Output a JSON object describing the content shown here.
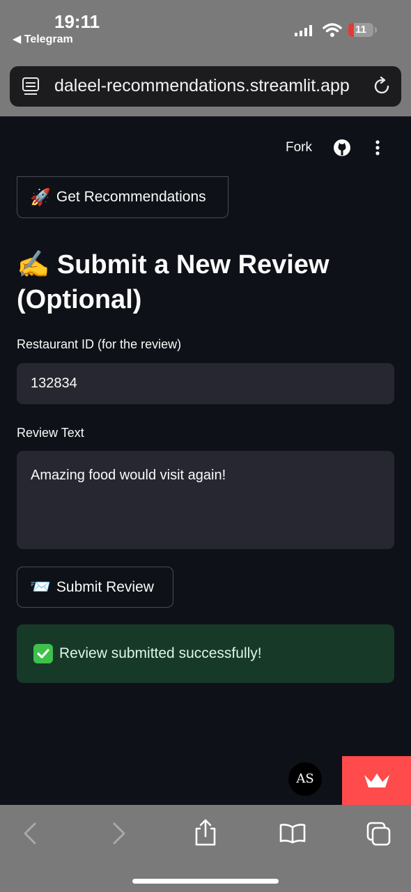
{
  "status": {
    "time": "19:11",
    "back_app": "Telegram",
    "battery": "11"
  },
  "browser": {
    "url": "daleel-recommendations.streamlit.app"
  },
  "header": {
    "fork_label": "Fork"
  },
  "recommend_button": {
    "emoji": "🚀",
    "label": "Get Recommendations"
  },
  "review_section": {
    "title": "✍️ Submit a New Review (Optional)",
    "restaurant_label": "Restaurant ID (for the review)",
    "restaurant_value": "132834",
    "review_label": "Review Text",
    "review_value": "Amazing food would visit again!",
    "submit_emoji": "📨",
    "submit_label": "Submit Review",
    "success_message": "Review submitted successfully!"
  },
  "avatar_text": "AS",
  "colors": {
    "accent": "#ff4b4b",
    "success_bg": "#173928",
    "page_bg": "#0e1117"
  }
}
